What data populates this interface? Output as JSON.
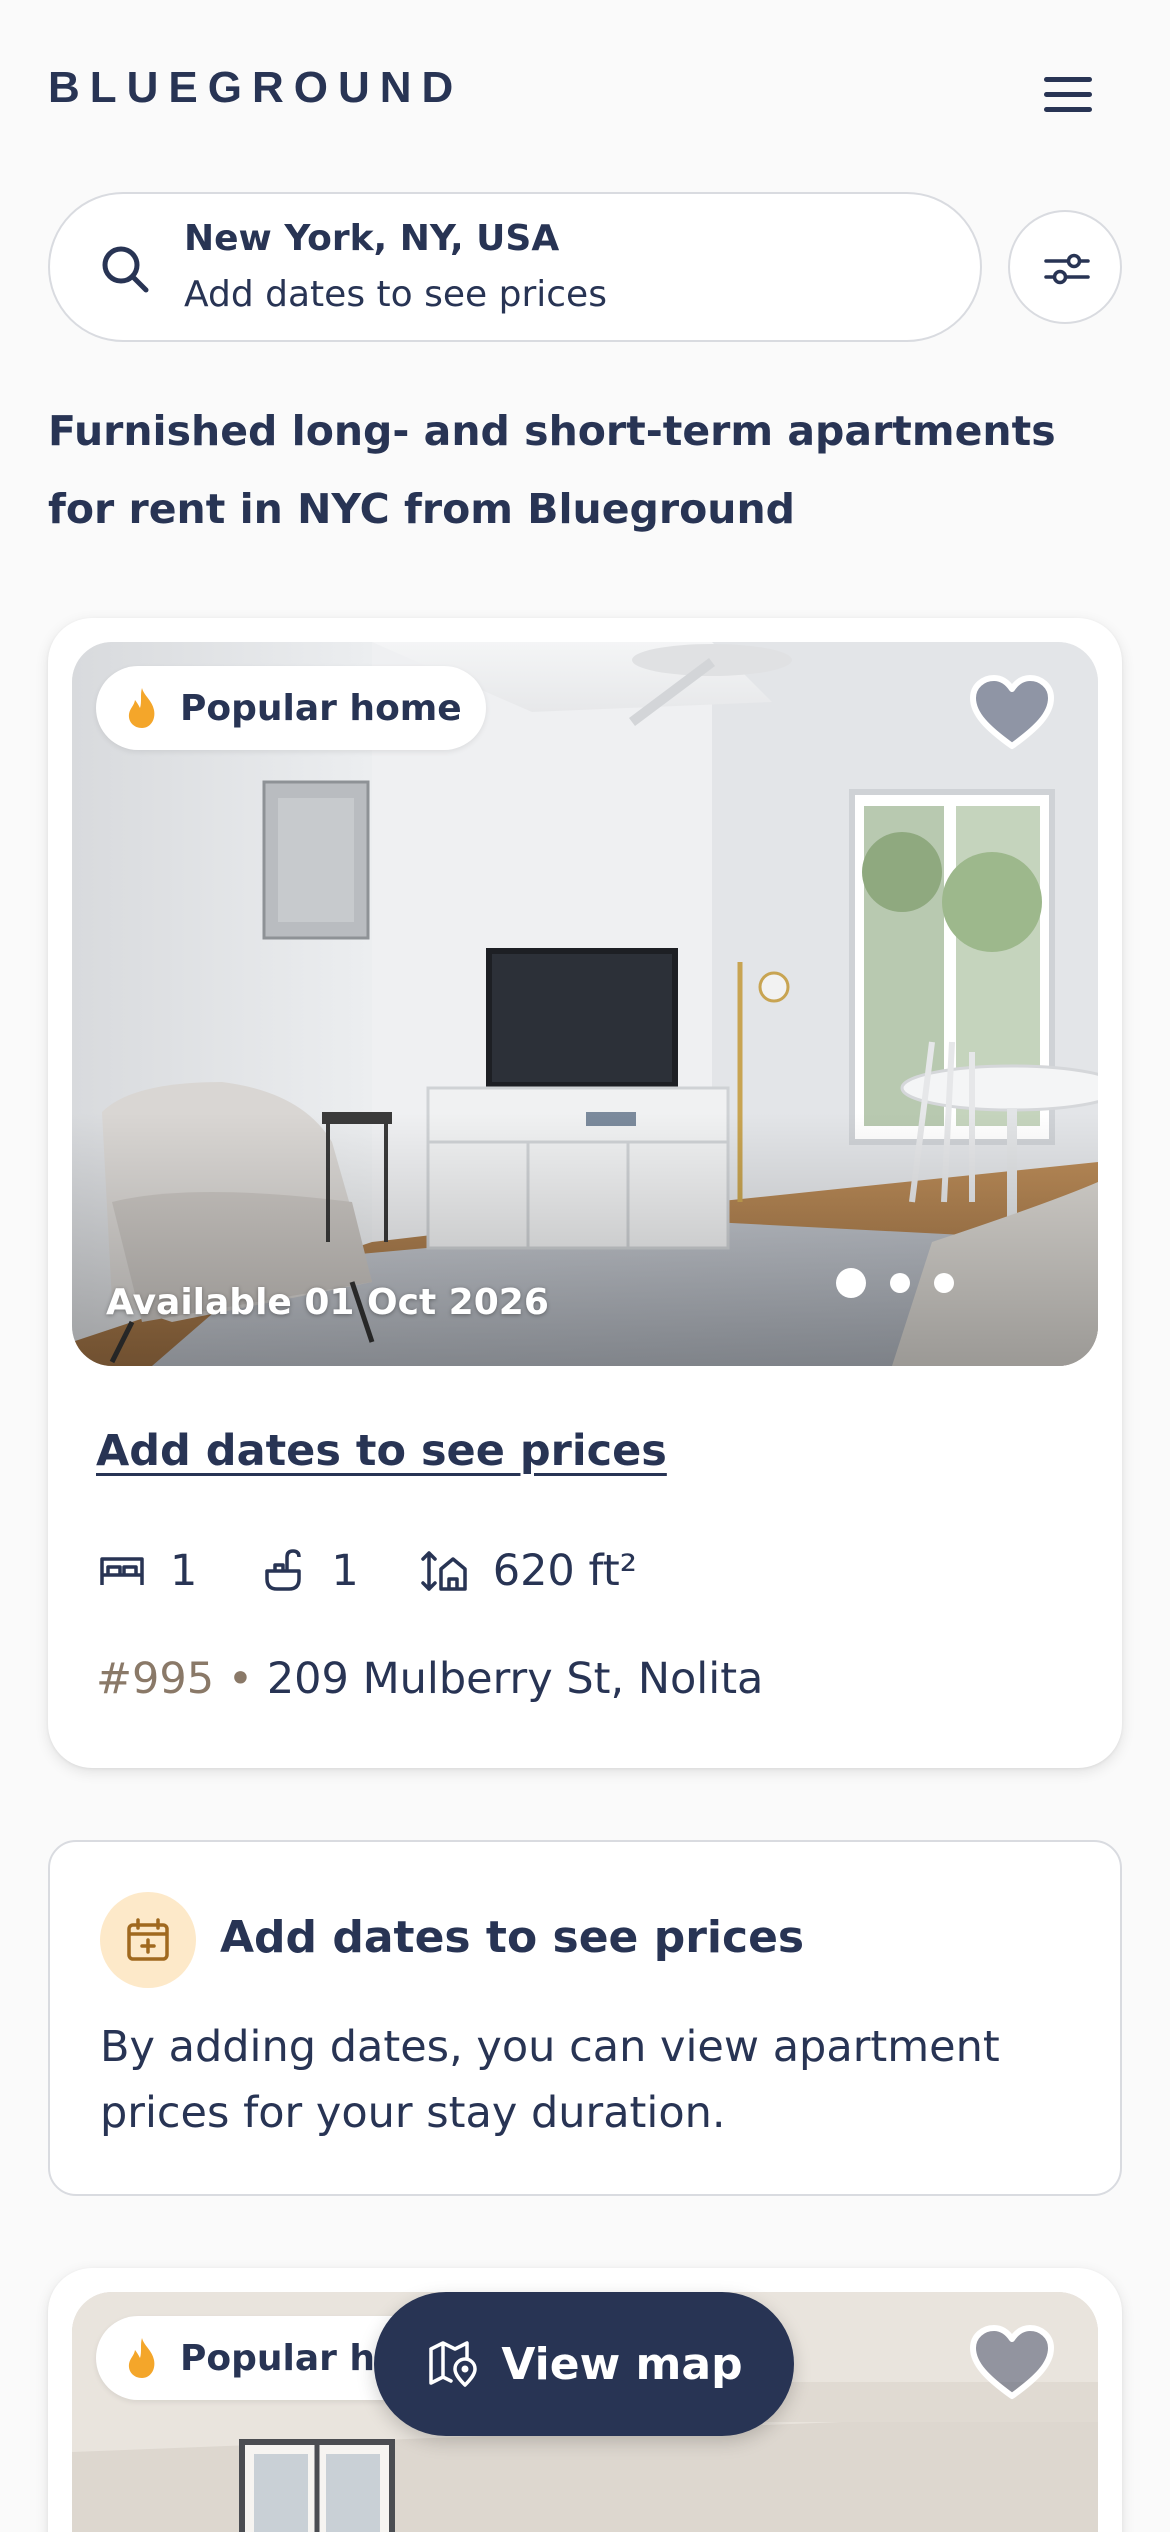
{
  "header": {
    "logo": "BLUEGROUND",
    "menu_icon": "hamburger-menu-icon"
  },
  "search": {
    "location": "New York, NY, USA",
    "dates": "Add dates to see prices",
    "icon": "search-icon",
    "filter_icon": "sliders-icon"
  },
  "page": {
    "title": "Furnished long- and short-term apartments for rent in NYC from Blueground"
  },
  "listings": [
    {
      "badge": "Popular home",
      "badge_icon": "flame-icon",
      "favorite_icon": "heart-icon",
      "availability": "Available 01 Oct 2026",
      "photo_count": 3,
      "active_photo": 1,
      "price_link": "Add dates to see prices",
      "bedrooms": "1",
      "bathrooms": "1",
      "area": "620 ft²",
      "listing_id": "#995",
      "separator": "•",
      "address": "209 Mulberry St, Nolita"
    },
    {
      "badge": "Popular home",
      "badge_icon": "flame-icon",
      "favorite_icon": "heart-icon"
    }
  ],
  "info_box": {
    "icon": "calendar-plus-icon",
    "title": "Add dates to see prices",
    "text": "By adding dates, you can view apartment prices for your stay duration."
  },
  "view_map": {
    "label": "View map",
    "icon": "map-pin-icon"
  },
  "colors": {
    "primary": "#283454",
    "badge_flame": "#f4a62a",
    "calendar_bg": "#fde9c9",
    "calendar_icon": "#a0691f",
    "listing_id": "#8a7968",
    "border": "#d9dbe0"
  }
}
